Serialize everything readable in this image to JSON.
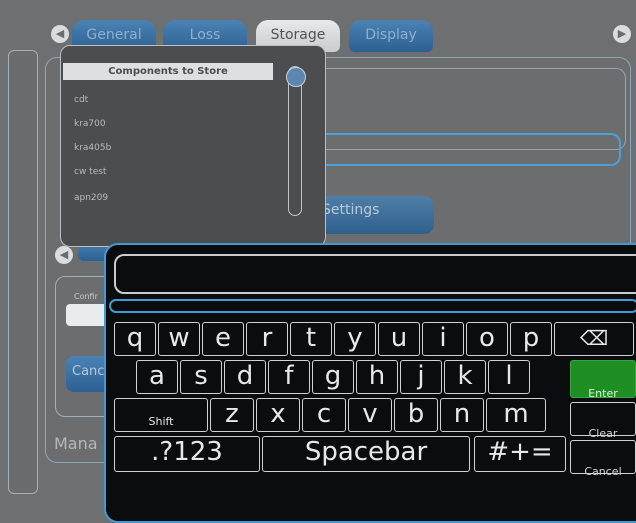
{
  "tabs": [
    "General",
    "Loss",
    "Storage",
    "Display"
  ],
  "active_tab": "Storage",
  "nav": {
    "prev_icon": "◀",
    "next_icon": "▶"
  },
  "components": {
    "header": "Components to Store",
    "items": [
      "cdt",
      "kra700",
      "kra405b",
      "cw test",
      "apn209"
    ]
  },
  "settings_label": "Settings",
  "confirm_label": "Confir",
  "cancel_label": "Canc",
  "manage_label": "Mana",
  "keyboard": {
    "row1": [
      "q",
      "w",
      "e",
      "r",
      "t",
      "y",
      "u",
      "i",
      "o",
      "p",
      "⌫"
    ],
    "row2": [
      "a",
      "s",
      "d",
      "f",
      "g",
      "h",
      "j",
      "k",
      "l"
    ],
    "row3": [
      "Shift",
      "z",
      "x",
      "c",
      "v",
      "b",
      "n",
      "m"
    ],
    "row4": [
      ".?123",
      "Spacebar",
      "#+="
    ],
    "enter": "Enter",
    "clear": "Clear",
    "cancel": "Cancel"
  }
}
